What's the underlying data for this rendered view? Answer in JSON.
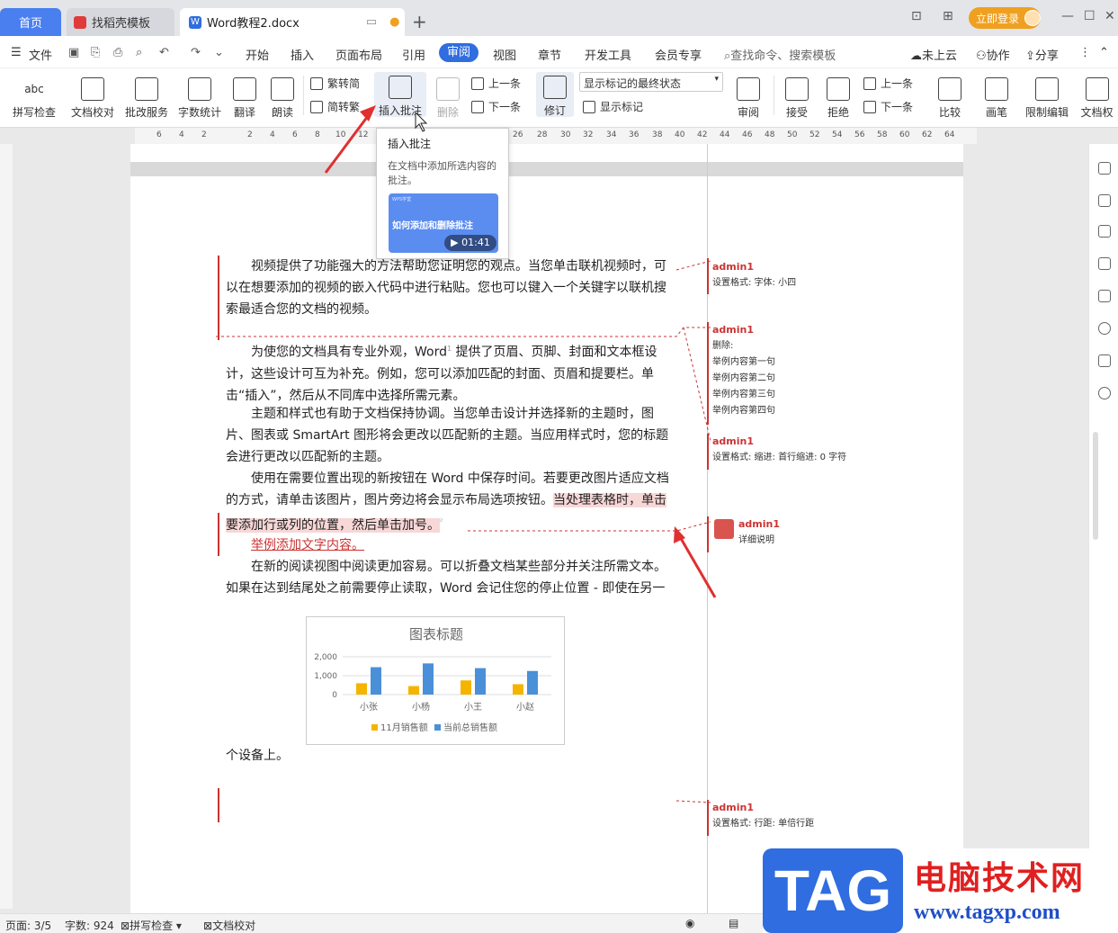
{
  "tabs": {
    "home": "首页",
    "daoke": "找稻壳模板",
    "doc": "Word教程2.docx",
    "login": "立即登录"
  },
  "menubar": {
    "file": "文件",
    "items": [
      "开始",
      "插入",
      "页面布局",
      "引用",
      "审阅",
      "视图",
      "章节",
      "开发工具",
      "会员专享"
    ],
    "search": "查找命令、搜索模板",
    "cloud": "未上云",
    "collab": "协作",
    "share": "分享"
  },
  "ribbon": {
    "spell": "拼写检查",
    "doccheck": "文档校对",
    "batch": "批改服务",
    "wordcount": "字数统计",
    "translate": "翻译",
    "read": "朗读",
    "trad": "繁转简",
    "simp": "简转繁",
    "insert_comment": "插入批注",
    "delete": "删除",
    "prev": "上一条",
    "next": "下一条",
    "revise": "修订",
    "markup_state": "显示标记的最终状态",
    "show_markup": "显示标记",
    "review": "审阅",
    "accept": "接受",
    "reject": "拒绝",
    "prev2": "上一条",
    "next2": "下一条",
    "compare": "比较",
    "pen": "画笔",
    "restrict": "限制编辑",
    "docperm": "文档权"
  },
  "ruler": [
    "6",
    "4",
    "2",
    "2",
    "4",
    "6",
    "8",
    "10",
    "12",
    "28",
    "30",
    "32",
    "34",
    "36",
    "38",
    "40",
    "42",
    "44",
    "46",
    "48",
    "50",
    "52",
    "54",
    "56",
    "58",
    "60",
    "62",
    "64",
    "26"
  ],
  "tooltip": {
    "title": "插入批注",
    "desc": "在文档中添加所选内容的批注。",
    "video_brand": "WPS学堂",
    "video_title": "如何添加和删除批注",
    "duration": "01:41"
  },
  "doc": {
    "p1": "视频提供了功能强大的方法帮助您证明您的观点。当您单击联机视频时，可以在想要添加的视频的嵌入代码中进行粘贴。您也可以键入一个关键字以联机搜索最适合您的文档的视频。",
    "p2": "为使您的文档具有专业外观，Word",
    "p2sup": "1",
    "p2b": " 提供了页眉、页脚、封面和文本框设计，这些设计可互为补充。例如，您可以添加匹配的封面、页眉和提要栏。单击“插入”，然后从不同库中选择所需元素。",
    "p3": "主题和样式也有助于文档保持协调。当您单击设计并选择新的主题时，图片、图表或 SmartArt 图形将会更改以匹配新的主题。当应用样式时，您的标题会进行更改以匹配新的主题。",
    "p4a": "使用在需要位置出现的新按钮在 Word 中保存时间。若要更改图片适应文档的方式，请单击该图片，图片旁边将会显示布局选项按钮。",
    "p4hl": "当处理表格时，单击要添加行或列的位置，然后单击加号。",
    "p4mark": "²",
    "ins": "举例添加文字内容。",
    "p5": "在新的阅读视图中阅读更加容易。可以折叠文档某些部分并关注所需文本。如果在达到结尾处之前需要停止读取，Word 会记住您的停止位置 - 即使在另一",
    "p6": "个设备上。"
  },
  "comments": [
    {
      "author": "admin1",
      "lines": [
        "设置格式: 字体: 小四"
      ]
    },
    {
      "author": "admin1",
      "lines": [
        "删除:",
        "举例内容第一句",
        "举例内容第二句",
        "举例内容第三句",
        "举例内容第四句"
      ]
    },
    {
      "author": "admin1",
      "lines": [
        "设置格式: 缩进: 首行缩进: 0 字符"
      ]
    },
    {
      "author": "admin1",
      "lines": [
        "详细说明"
      ]
    },
    {
      "author": "admin1",
      "lines": [
        "设置格式: 行距: 单倍行距"
      ]
    }
  ],
  "chart_data": {
    "type": "bar",
    "title": "图表标题",
    "categories": [
      "小张",
      "小杨",
      "小王",
      "小赵"
    ],
    "series": [
      {
        "name": "11月销售额",
        "values": [
          600,
          450,
          750,
          550
        ],
        "color": "#f5b400"
      },
      {
        "name": "当前总销售额",
        "values": [
          1450,
          1650,
          1400,
          1250
        ],
        "color": "#4a90d9"
      }
    ],
    "yticks": [
      "2,000",
      "1,000",
      "0"
    ],
    "ylim": [
      0,
      2000
    ],
    "legend": "bottom"
  },
  "status": {
    "page": "页面: 3/5",
    "words": "字数: 924",
    "spell": "拼写检查",
    "doccheck": "文档校对"
  },
  "watermark": {
    "tag": "TAG",
    "cn": "电脑技术网",
    "url": "www.tagxp.com"
  }
}
